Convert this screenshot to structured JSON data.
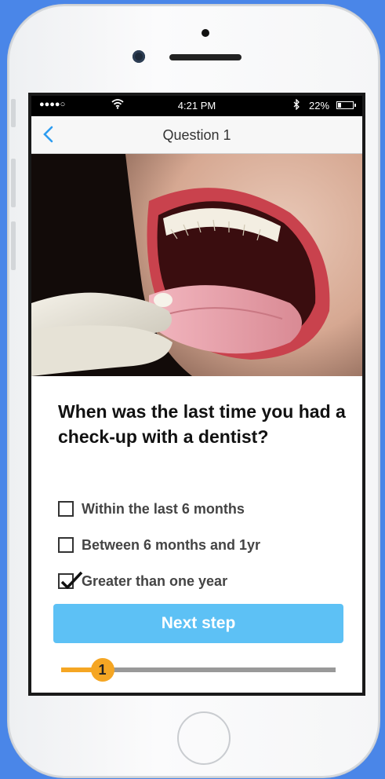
{
  "status_bar": {
    "signal": "●●●●○",
    "time": "4:21 PM",
    "battery_text": "22%",
    "battery_level": 0.22
  },
  "nav": {
    "title": "Question 1",
    "back_icon": "chevron-left-icon"
  },
  "question": {
    "text": "When was the last time you had a check-up with a dentist?",
    "options": [
      {
        "label": "Within the last 6 months",
        "checked": false
      },
      {
        "label": "Between 6 months and 1yr",
        "checked": false
      },
      {
        "label": "Greater than one year",
        "checked": true
      }
    ]
  },
  "next_button": {
    "label": "Next step"
  },
  "progress": {
    "step_label": "1",
    "value": 0.15
  },
  "colors": {
    "background": "#4a86e8",
    "accent_blue": "#5dc1f5",
    "progress_orange": "#f5a623",
    "back_chevron": "#2d9cf0"
  }
}
